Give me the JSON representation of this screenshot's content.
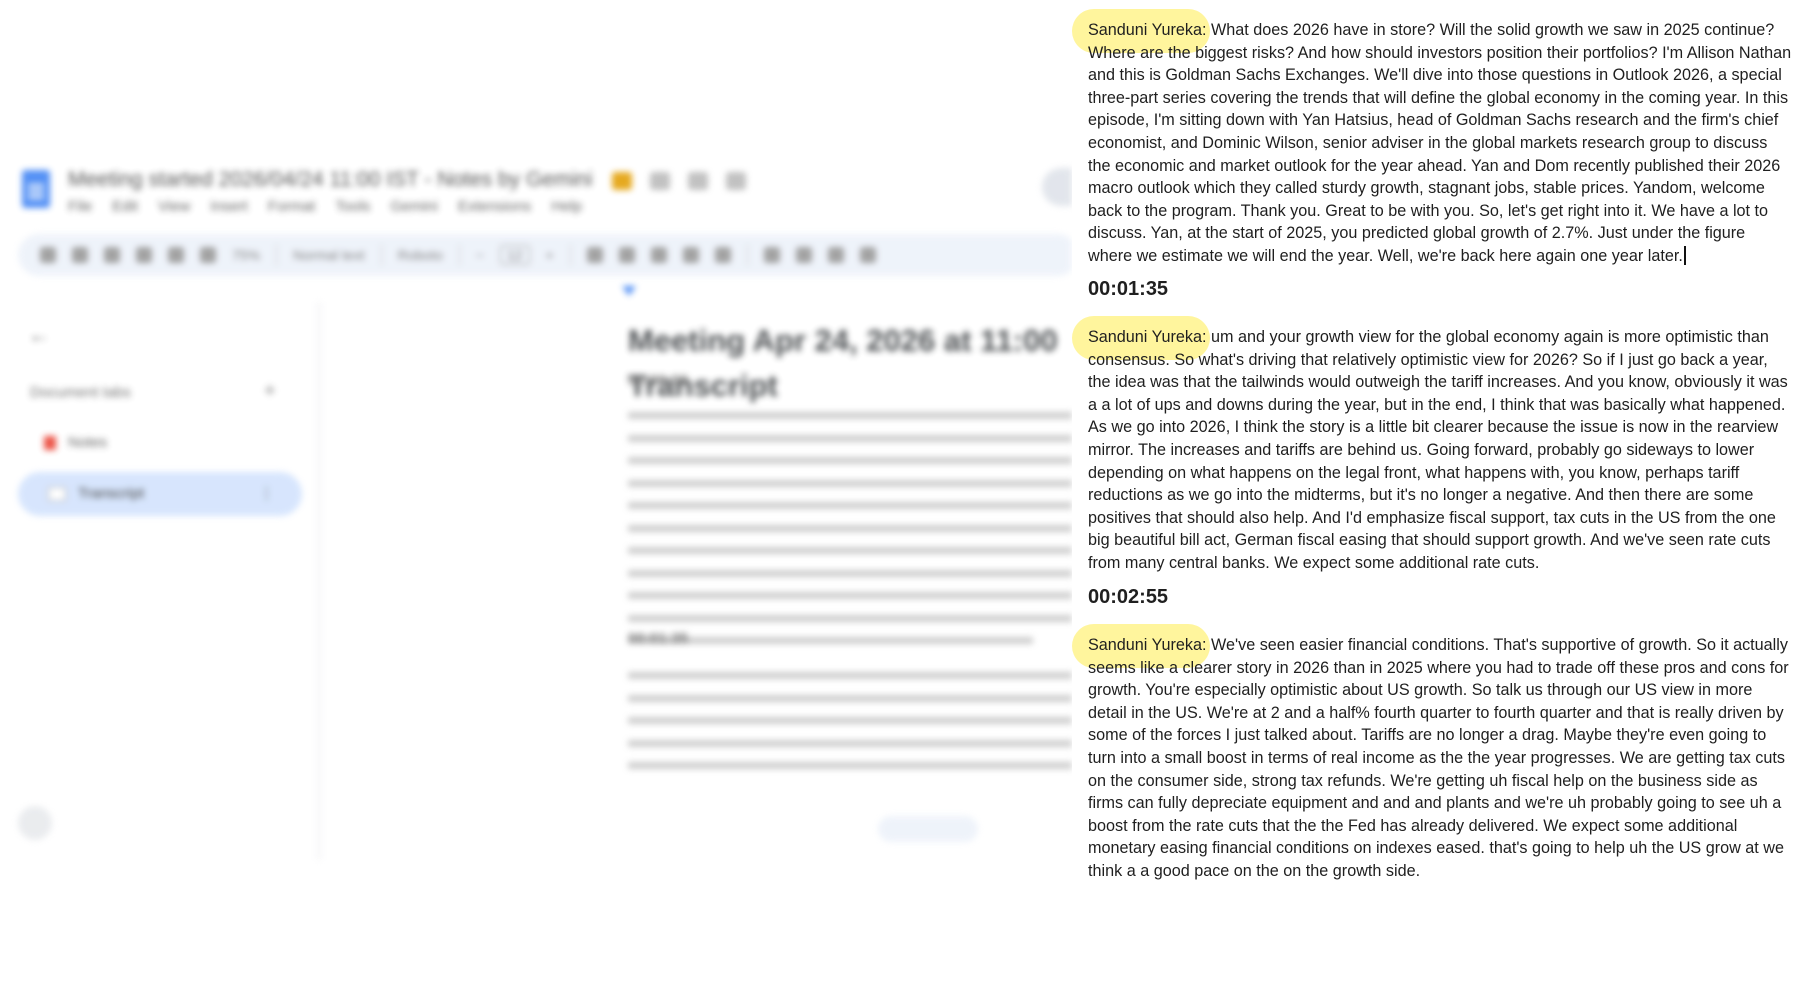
{
  "docs": {
    "title": "Meeting started 2026/04/24 11:00 IST - Notes by Gemini",
    "menu": [
      "File",
      "Edit",
      "View",
      "Insert",
      "Format",
      "Tools",
      "Gemini",
      "Extensions",
      "Help"
    ],
    "toolbar": {
      "zoom": "75%",
      "style": "Normal text",
      "font": "Roboto",
      "font_size": "12"
    },
    "sidebar": {
      "tabs_label": "Document tabs",
      "tabs": [
        {
          "label": "Notes"
        },
        {
          "label": "Transcript",
          "active": true
        }
      ]
    },
    "page": {
      "heading_line1": "Meeting Apr 24, 2026 at 11:00",
      "heading_line2": "Transcript",
      "ts1": "00:00:00",
      "ts2": "00:01:35"
    }
  },
  "transcript": {
    "highlight_color": "#fff59d",
    "segments": [
      {
        "speaker": "Sanduni Yureka:",
        "text": "What does 2026 have in store? Will the solid growth we saw in 2025 continue? Where are the biggest risks? And how should investors position their portfolios? I'm Allison Nathan and this is Goldman Sachs Exchanges. We'll dive into those questions in Outlook 2026, a special three-part series covering the trends that will define the global economy in the coming year. In this episode, I'm sitting down with Yan Hatsius, head of Goldman Sachs research and the firm's chief economist, and Dominic Wilson, senior adviser in the global markets research group to discuss the economic and market outlook for the year ahead. Yan and Dom recently published their 2026 macro outlook which they called sturdy growth, stagnant jobs, stable prices. Yandom, welcome back to the program. Thank you. Great to be with you. So, let's get right into it. We have a lot to discuss. Yan, at the start of 2025, you predicted global growth of 2.7%. Just under the figure where we estimate we will end the year. Well, we're back here again one year later."
      },
      {
        "timestamp": "00:01:35",
        "speaker": "Sanduni Yureka:",
        "text": "um and your growth view for the global economy again is more optimistic than consensus. So what's driving that relatively optimistic view for 2026? So if I just go back a year, the idea was that the tailwinds would outweigh the tariff increases. And you know, obviously it was a a lot of ups and downs during the year, but in the end, I think that was basically what happened. As we go into 2026, I think the story is a little bit clearer because the issue is now in the rearview mirror. The increases and tariffs are behind us. Going forward, probably go sideways to lower depending on what happens on the legal front, what happens with, you know, perhaps tariff reductions as we go into the midterms, but it's no longer a negative. And then there are some positives that should also help. And I'd emphasize fiscal support, tax cuts in the US from the one big beautiful bill act, German fiscal easing that should support growth. And we've seen rate cuts from many central banks. We expect some additional rate cuts."
      },
      {
        "timestamp": "00:02:55",
        "speaker": "Sanduni Yureka:",
        "text": "We've seen easier financial conditions. That's supportive of growth. So it actually seems like a clearer story in 2026 than in 2025 where you had to trade off these pros and cons for growth. You're especially optimistic about US growth. So talk us through our US view in more detail in the US. We're at 2 and a half% fourth quarter to fourth quarter and that is really driven by some of the forces I just talked about. Tariffs are no longer a drag. Maybe they're even going to turn into a small boost in terms of real income as the the year progresses. We are getting tax cuts on the consumer side, strong tax refunds. We're getting uh fiscal help on the business side as firms can fully depreciate equipment and and and plants and we're uh probably going to see uh a boost from the rate cuts that the the Fed has already delivered. We expect some additional monetary easing financial conditions on indexes eased. that's going to help uh the US grow at we think a a good pace on the on the growth side."
      }
    ]
  }
}
